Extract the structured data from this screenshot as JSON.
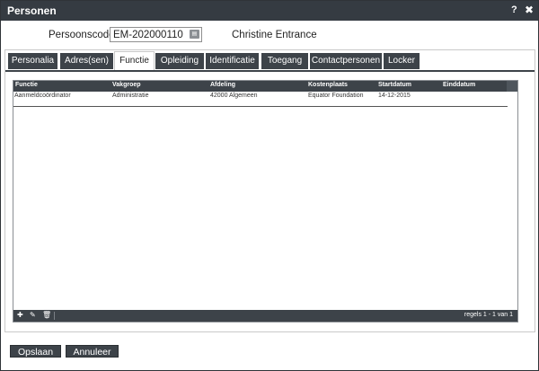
{
  "window": {
    "title": "Personen",
    "help_label": "?",
    "close_label": "✖"
  },
  "person": {
    "code_label": "Persoonscode:",
    "code_value": "EM-202000110",
    "lookup_icon": "id-card-icon",
    "name": "Christine Entrance"
  },
  "tabs": [
    {
      "label": "Personalia"
    },
    {
      "label": "Adres(sen)"
    },
    {
      "label": "Functie"
    },
    {
      "label": "Opleiding"
    },
    {
      "label": "Identificatie"
    },
    {
      "label": "Toegang"
    },
    {
      "label": "Contactpersonen"
    },
    {
      "label": "Locker"
    }
  ],
  "active_tab": "Functie",
  "grid": {
    "columns": [
      "Functie",
      "Vakgroep",
      "Afdeling",
      "Kostenplaats",
      "Startdatum",
      "Einddatum"
    ],
    "rows": [
      [
        "Aanmeldcoördinator",
        "Administratie",
        "42000 Algemeen",
        "Equator Foundation",
        "14-12-2015",
        ""
      ]
    ],
    "footer": {
      "add_icon": "plus-icon",
      "edit_icon": "pencil-icon",
      "delete_icon": "trash-icon",
      "pager_text": "regels 1 - 1 van 1"
    }
  },
  "actions": {
    "save_label": "Opslaan",
    "cancel_label": "Annuleer"
  },
  "colors": {
    "titlebar": "#353b42",
    "tab": "#3d4349",
    "grid_header": "#3d4349"
  }
}
